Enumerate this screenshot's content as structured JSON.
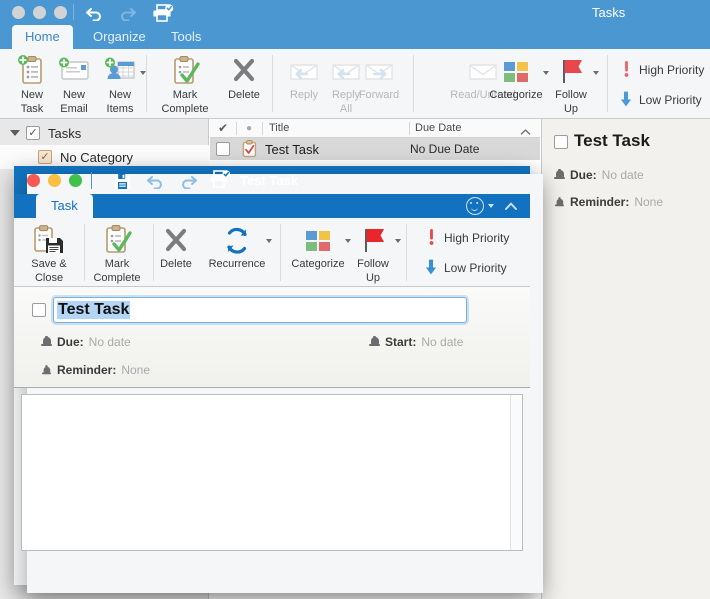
{
  "main_window": {
    "title": "Tasks",
    "traffic_lights": [
      "close",
      "minimize",
      "maximize"
    ],
    "toolbar_icons": [
      "undo-icon",
      "redo-icon",
      "print-icon"
    ],
    "tabs": [
      {
        "label": "Home",
        "active": true
      },
      {
        "label": "Organize",
        "active": false
      },
      {
        "label": "Tools",
        "active": false
      }
    ],
    "ribbon": {
      "groups": [
        {
          "items": [
            {
              "label_line1": "New",
              "label_line2": "Task",
              "icon": "new-task-icon",
              "dimmed": false,
              "caret": false
            },
            {
              "label_line1": "New",
              "label_line2": "Email",
              "icon": "new-email-icon",
              "dimmed": false,
              "caret": false
            },
            {
              "label_line1": "New",
              "label_line2": "Items",
              "icon": "new-items-icon",
              "dimmed": false,
              "caret": true
            }
          ]
        },
        {
          "items": [
            {
              "label_line1": "Mark",
              "label_line2": "Complete",
              "icon": "mark-complete-icon",
              "dimmed": false,
              "caret": false
            },
            {
              "label_line1": "Delete",
              "label_line2": "",
              "icon": "delete-icon",
              "dimmed": false,
              "caret": false
            }
          ]
        },
        {
          "items": [
            {
              "label_line1": "Reply",
              "label_line2": "",
              "icon": "reply-icon",
              "dimmed": true,
              "caret": false
            },
            {
              "label_line1": "Reply",
              "label_line2": "All",
              "icon": "reply-all-icon",
              "dimmed": true,
              "caret": false
            },
            {
              "label_line1": "Forward",
              "label_line2": "",
              "icon": "forward-icon",
              "dimmed": true,
              "caret": false
            }
          ]
        },
        {
          "items": [
            {
              "label_line1": "Read/Unread",
              "label_line2": "",
              "icon": "read-unread-icon",
              "dimmed": true,
              "caret": false
            },
            {
              "label_line1": "Categorize",
              "label_line2": "",
              "icon": "categorize-icon",
              "dimmed": false,
              "caret": true
            },
            {
              "label_line1": "Follow",
              "label_line2": "Up",
              "icon": "follow-up-flag-icon",
              "dimmed": false,
              "caret": true
            }
          ]
        }
      ],
      "priority": [
        {
          "label": "High Priority",
          "icon": "high-priority-exclamation-icon",
          "color": "#e8646a"
        },
        {
          "label": "Low Priority",
          "icon": "low-priority-arrow-icon",
          "color": "#4a9ad8"
        }
      ]
    }
  },
  "sidebar": {
    "items": [
      {
        "label": "Tasks",
        "checked": true,
        "expanded": true,
        "level": 0,
        "selected": false
      },
      {
        "label": "No Category",
        "checked": true,
        "expanded": false,
        "level": 1,
        "selected": true
      }
    ]
  },
  "list_pane": {
    "columns": [
      {
        "label": "check-column",
        "glyph": "✔"
      },
      {
        "label": "flag-column",
        "glyph": "●"
      },
      {
        "label": "Title"
      },
      {
        "label": "Due Date",
        "sort_indicator": "chevron-up-icon"
      }
    ],
    "rows": [
      {
        "checked": false,
        "icon": "task-clipboard-icon",
        "title": "Test Task",
        "due_date": "No Due Date",
        "selected": true
      }
    ]
  },
  "reading_pane": {
    "title": "Test Task",
    "checked": false,
    "fields": [
      {
        "icon": "bell-icon",
        "key": "Due:",
        "value": "No date"
      },
      {
        "icon": "bell-icon",
        "key": "Reminder:",
        "value": "None"
      }
    ]
  },
  "child_window": {
    "title": "Test Task",
    "traffic_lights": [
      "close",
      "minimize",
      "maximize"
    ],
    "toolbar_icons": [
      "save-icon",
      "undo-icon",
      "redo-icon",
      "print-icon"
    ],
    "right_controls": [
      "smiley-icon",
      "chevron-down-icon",
      "collapse-ribbon-chevron-icon"
    ],
    "tabs": [
      {
        "label": "Task",
        "active": true
      }
    ],
    "ribbon": {
      "items": [
        {
          "label_line1": "Save &",
          "label_line2": "Close",
          "icon": "save-close-icon",
          "caret": false
        },
        {
          "label_line1": "Mark",
          "label_line2": "Complete",
          "icon": "mark-complete-icon",
          "caret": false
        },
        {
          "label_line1": "Delete",
          "label_line2": "",
          "icon": "delete-icon",
          "caret": false
        },
        {
          "label_line1": "Recurrence",
          "label_line2": "",
          "icon": "recurrence-icon",
          "caret": true
        },
        {
          "label_line1": "Categorize",
          "label_line2": "",
          "icon": "categorize-icon",
          "caret": true
        },
        {
          "label_line1": "Follow",
          "label_line2": "Up",
          "icon": "follow-up-flag-icon",
          "caret": true
        }
      ],
      "priority": [
        {
          "label": "High Priority",
          "icon": "high-priority-exclamation-icon",
          "color": "#e8646a"
        },
        {
          "label": "Low Priority",
          "icon": "low-priority-arrow-icon",
          "color": "#4a9ad8"
        }
      ]
    },
    "form": {
      "title_value": "Test Task",
      "title_checked": false,
      "fields": [
        {
          "icon": "bell-icon",
          "key": "Due:",
          "value": "No date"
        },
        {
          "icon": "bell-icon",
          "key": "Start:",
          "value": "No date"
        },
        {
          "icon": "bell-icon",
          "key": "Reminder:",
          "value": "None"
        }
      ],
      "notes_value": ""
    }
  },
  "colors": {
    "main_titlebar": "#4a97d2",
    "child_titlebar": "#1272bf",
    "ribbon_bg": "#f4f6f7",
    "sidebar_bg": "#e8e8e8",
    "selection_blue": "#b3d6f7"
  }
}
